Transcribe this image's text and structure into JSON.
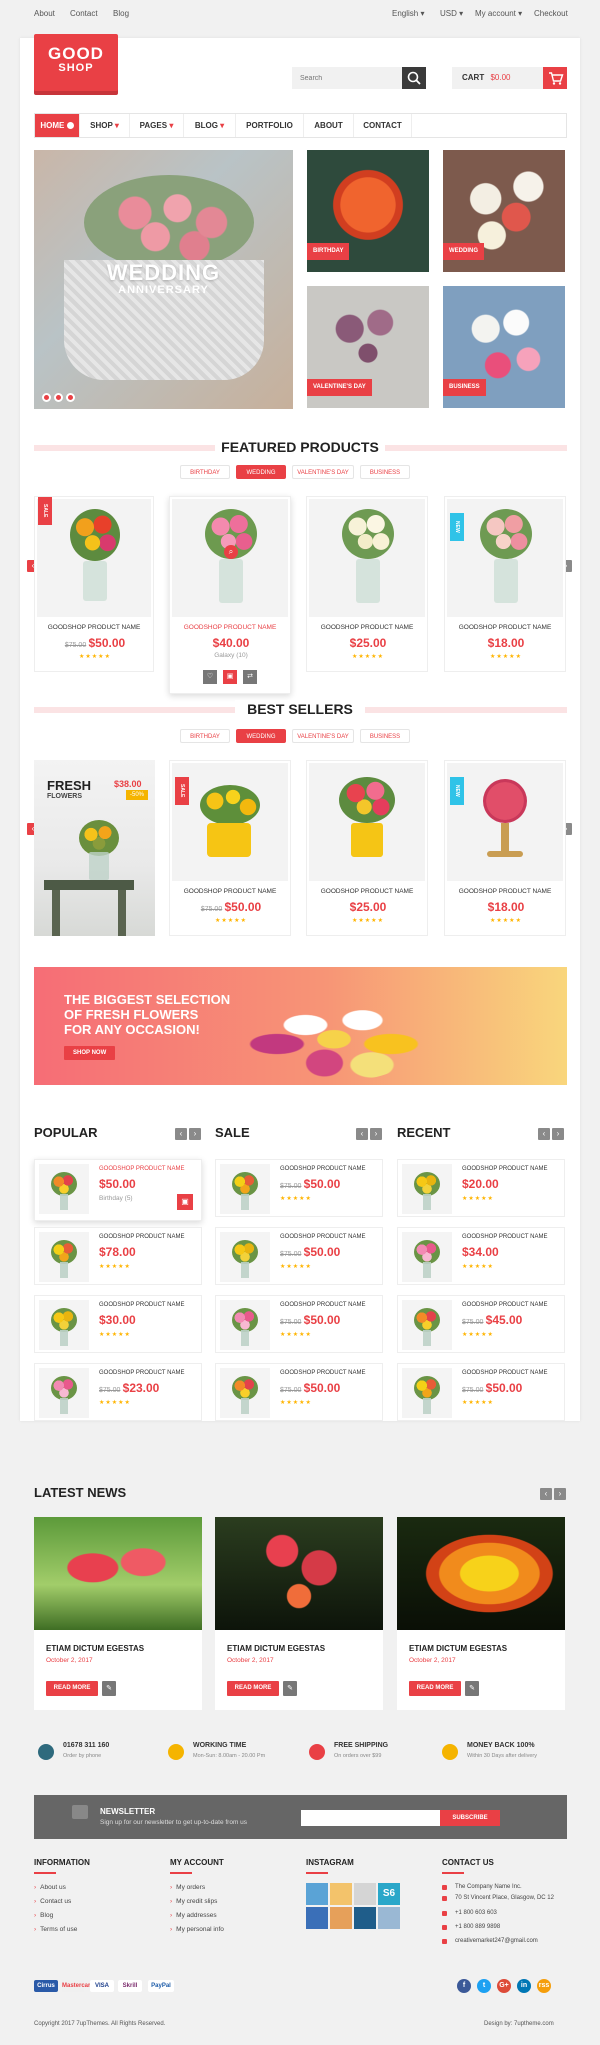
{
  "topbar": {
    "left": [
      "About",
      "Contact",
      "Blog"
    ],
    "right": [
      "English",
      "USD",
      "My account",
      "Checkout"
    ]
  },
  "logo": {
    "line1": "GOOD",
    "line2": "SHOP"
  },
  "search": {
    "placeholder": "Search"
  },
  "cart": {
    "label": "CART",
    "amount": "$0.00"
  },
  "nav": [
    "HOME",
    "SHOP",
    "PAGES",
    "BLOG",
    "PORTFOLIO",
    "ABOUT",
    "CONTACT"
  ],
  "hero": {
    "title": "WEDDING",
    "subtitle": "ANNIVERSARY"
  },
  "tiles": [
    "BIRTHDAY",
    "WEDDING",
    "VALENTINE'S DAY",
    "BUSINESS"
  ],
  "featured": {
    "title": "FEATURED PRODUCTS",
    "tabs": [
      "BIRTHDAY",
      "WEDDING",
      "VALENTINE'S DAY",
      "BUSINESS"
    ],
    "products": [
      {
        "name": "GOODSHOP PRODUCT NAME",
        "old": "$75.00",
        "price": "$50.00",
        "badge": "SALE"
      },
      {
        "name": "GOODSHOP PRODUCT NAME",
        "price": "$40.00",
        "extra": "Galaxy (10)"
      },
      {
        "name": "GOODSHOP PRODUCT NAME",
        "price": "$25.00"
      },
      {
        "name": "GOODSHOP PRODUCT NAME",
        "price": "$18.00",
        "badge": "NEW"
      }
    ]
  },
  "bestsellers": {
    "title": "BEST SELLERS",
    "tabs": [
      "BIRTHDAY",
      "WEDDING",
      "VALENTINE'S DAY",
      "BUSINESS"
    ],
    "promo": {
      "line1": "FRESH",
      "line2": "FLOWERS",
      "price": "$38.00",
      "discount": "-50%"
    },
    "products": [
      {
        "name": "GOODSHOP PRODUCT NAME",
        "old": "$75.00",
        "price": "$50.00",
        "badge": "SALE"
      },
      {
        "name": "GOODSHOP PRODUCT NAME",
        "price": "$25.00"
      },
      {
        "name": "GOODSHOP PRODUCT NAME",
        "price": "$18.00",
        "badge": "NEW"
      }
    ]
  },
  "banner": {
    "line1": "THE BIGGEST SELECTION",
    "line2": "OF FRESH FLOWERS",
    "line3": "FOR ANY OCCASION!",
    "button": "SHOP NOW"
  },
  "lists": [
    {
      "title": "POPULAR",
      "items": [
        {
          "name": "GOODSHOP PRODUCT NAME",
          "price": "$50.00",
          "extra": "Birthday (5)"
        },
        {
          "name": "GOODSHOP PRODUCT NAME",
          "price": "$78.00"
        },
        {
          "name": "GOODSHOP PRODUCT NAME",
          "price": "$30.00"
        },
        {
          "name": "GOODSHOP PRODUCT NAME",
          "old": "$75.00",
          "price": "$23.00"
        }
      ]
    },
    {
      "title": "SALE",
      "items": [
        {
          "name": "GOODSHOP PRODUCT NAME",
          "old": "$75.00",
          "price": "$50.00"
        },
        {
          "name": "GOODSHOP PRODUCT NAME",
          "old": "$75.00",
          "price": "$50.00"
        },
        {
          "name": "GOODSHOP PRODUCT NAME",
          "old": "$75.00",
          "price": "$50.00"
        },
        {
          "name": "GOODSHOP PRODUCT NAME",
          "old": "$75.00",
          "price": "$50.00"
        }
      ]
    },
    {
      "title": "RECENT",
      "items": [
        {
          "name": "GOODSHOP PRODUCT NAME",
          "price": "$20.00"
        },
        {
          "name": "GOODSHOP PRODUCT NAME",
          "price": "$34.00"
        },
        {
          "name": "GOODSHOP PRODUCT NAME",
          "old": "$75.00",
          "price": "$45.00"
        },
        {
          "name": "GOODSHOP PRODUCT NAME",
          "old": "$75.00",
          "price": "$50.00"
        }
      ]
    }
  ],
  "news": {
    "title": "LATEST NEWS",
    "items": [
      {
        "title": "ETIAM DICTUM EGESTAS",
        "date": "October 2, 2017",
        "button": "READ MORE"
      },
      {
        "title": "ETIAM DICTUM EGESTAS",
        "date": "October 2, 2017",
        "button": "READ MORE"
      },
      {
        "title": "ETIAM DICTUM EGESTAS",
        "date": "October 2, 2017",
        "button": "READ MORE"
      }
    ]
  },
  "features": [
    {
      "title": "01678 311 160",
      "sub": "Order by phone"
    },
    {
      "title": "WORKING TIME",
      "sub": "Mon-Sun: 8.00am - 20.00 Pm"
    },
    {
      "title": "FREE SHIPPING",
      "sub": "On orders over $99"
    },
    {
      "title": "MONEY BACK 100%",
      "sub": "Within 30 Days after delivery"
    }
  ],
  "newsletter": {
    "title": "NEWSLETTER",
    "sub": "Sign up for our newsletter to get up-to-date from us",
    "button": "SUBSCRIBE"
  },
  "footer": {
    "information": {
      "title": "INFORMATION",
      "links": [
        "About us",
        "Contact us",
        "Blog",
        "Terms of use"
      ]
    },
    "account": {
      "title": "MY ACCOUNT",
      "links": [
        "My orders",
        "My credit slips",
        "My addresses",
        "My personal info"
      ]
    },
    "instagram": {
      "title": "INSTAGRAM",
      "s6": "S6"
    },
    "contact": {
      "title": "CONTACT US",
      "lines": [
        "The Company Name Inc.",
        "70 St Vincent Place, Glasgow, DC 12",
        "+1 800 603 603",
        "+1 800 889 9898",
        "creativemarket247@gmail.com"
      ]
    },
    "payments": [
      "Cirrus",
      "Mastercard",
      "VISA",
      "Skrill",
      "PayPal"
    ],
    "social": [
      "f",
      "t",
      "G+",
      "in",
      "rss"
    ],
    "copyright": "Copyright 2017 7upThemes. All Rights Reserved.",
    "design": "Design by: 7uptheme.com"
  },
  "colors": {
    "accent": "#e94045",
    "dark": "#3a3a3a",
    "gold": "#ffb400"
  }
}
